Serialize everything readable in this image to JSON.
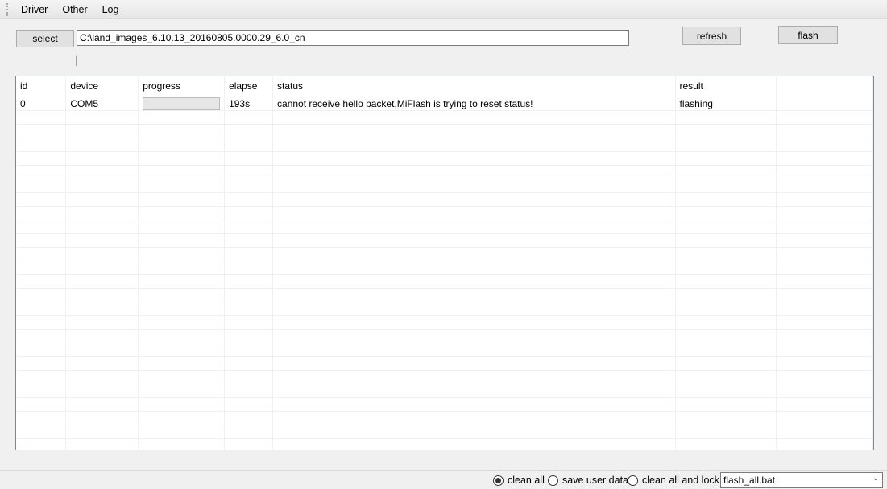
{
  "menu": [
    "Driver",
    "Other",
    "Log"
  ],
  "toolbar": {
    "select_label": "select",
    "path_value": "C:\\land_images_6.10.13_20160805.0000.29_6.0_cn",
    "refresh_label": "refresh",
    "flash_label": "flash"
  },
  "table": {
    "columns": [
      "id",
      "device",
      "progress",
      "elapse",
      "status",
      "result",
      ""
    ],
    "rows": [
      {
        "id": "0",
        "device": "COM5",
        "progress": 0,
        "elapse": "193s",
        "status": "cannot receive hello packet,MiFlash is trying to reset status!",
        "result": "flashing"
      }
    ]
  },
  "options": {
    "clean_all": "clean all",
    "save_user_data": "save user data",
    "clean_all_lock": "clean all and lock",
    "selected": "clean all",
    "script": "flash_all.bat"
  },
  "colors": {
    "progress_fill": "#06b025"
  }
}
